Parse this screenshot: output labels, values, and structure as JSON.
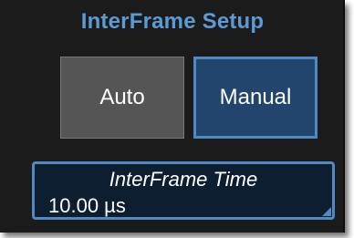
{
  "title": "InterFrame Setup",
  "mode_buttons": {
    "auto_label": "Auto",
    "manual_label": "Manual",
    "selected": "Manual"
  },
  "interframe_time": {
    "label": "InterFrame Time",
    "value": "10.00 µs"
  },
  "colors": {
    "panel_background": "#1b1b1b",
    "title": "#5b9bd5",
    "selected_fill": "#21456d",
    "selected_border": "#4f8ac4",
    "unselected_fill": "#555555"
  }
}
